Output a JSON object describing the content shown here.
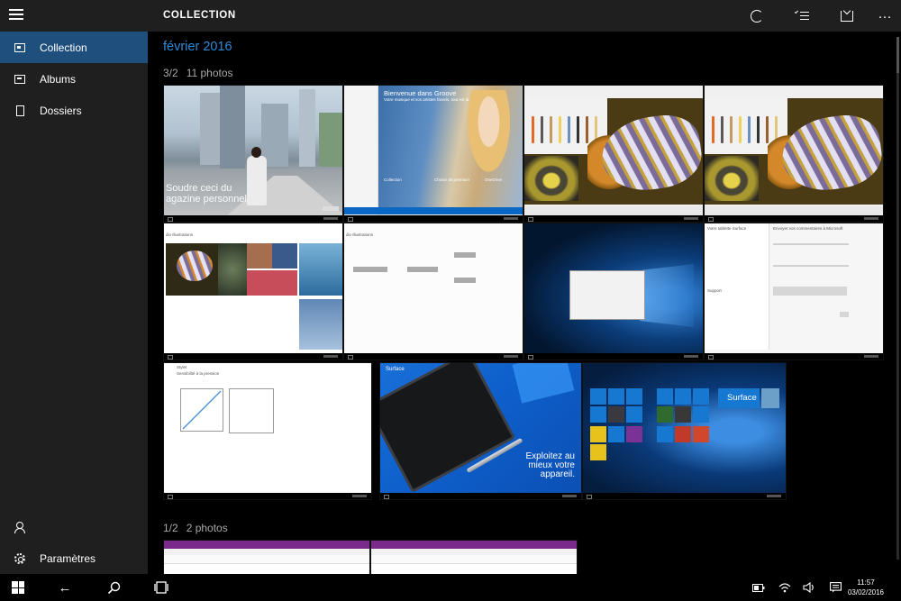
{
  "app": {
    "title": "COLLECTION"
  },
  "sidebar": {
    "items": [
      {
        "label": "Collection",
        "icon": "photos-icon",
        "active": true
      },
      {
        "label": "Albums",
        "icon": "album-icon",
        "active": false
      },
      {
        "label": "Dossiers",
        "icon": "folder-icon",
        "active": false
      }
    ],
    "settings_label": "Paramètres"
  },
  "header": {
    "actions": [
      {
        "name": "refresh-icon"
      },
      {
        "name": "select-icon"
      },
      {
        "name": "import-icon"
      },
      {
        "name": "more-icon",
        "glyph": "···"
      }
    ]
  },
  "content": {
    "month": "février 2016",
    "groups": [
      {
        "date": "3/2",
        "count": "11 photos"
      },
      {
        "date": "1/2",
        "count": "2 photos"
      }
    ],
    "thumb_text": {
      "street_overlay_line1": "Soudre ceci du",
      "street_overlay_line2": "agazine personnel",
      "groove_title": "Bienvenue dans Groove",
      "groove_sub": "Votre musique et vos artistes favoris, tout est là",
      "groove_col1": "Collection",
      "groove_col2": "Choisir de premium",
      "groove_col3": "OneDrive",
      "onenote_title": "dio Illustrations",
      "blank_title": "dio Illustrations",
      "settings_left_title": "Votre tablette Surface",
      "settings_right_title": "Envoyer vos commentaires à Microsoft",
      "settings_support": "Support",
      "stylet_title": "Stylet",
      "stylet_sub": "Sensibilité à la pression",
      "surface_title": "Surface",
      "surface_tagline_1": "Exploitez au",
      "surface_tagline_2": "mieux votre",
      "surface_tagline_3": "appareil.",
      "start_label": "Surface"
    }
  },
  "taskbar": {
    "time": "11:57",
    "date": "03/02/2016"
  },
  "colors": {
    "accent": "#2c8ad8",
    "sidebar_active": "#1e4f7d",
    "chrome": "#1f1f1f"
  }
}
